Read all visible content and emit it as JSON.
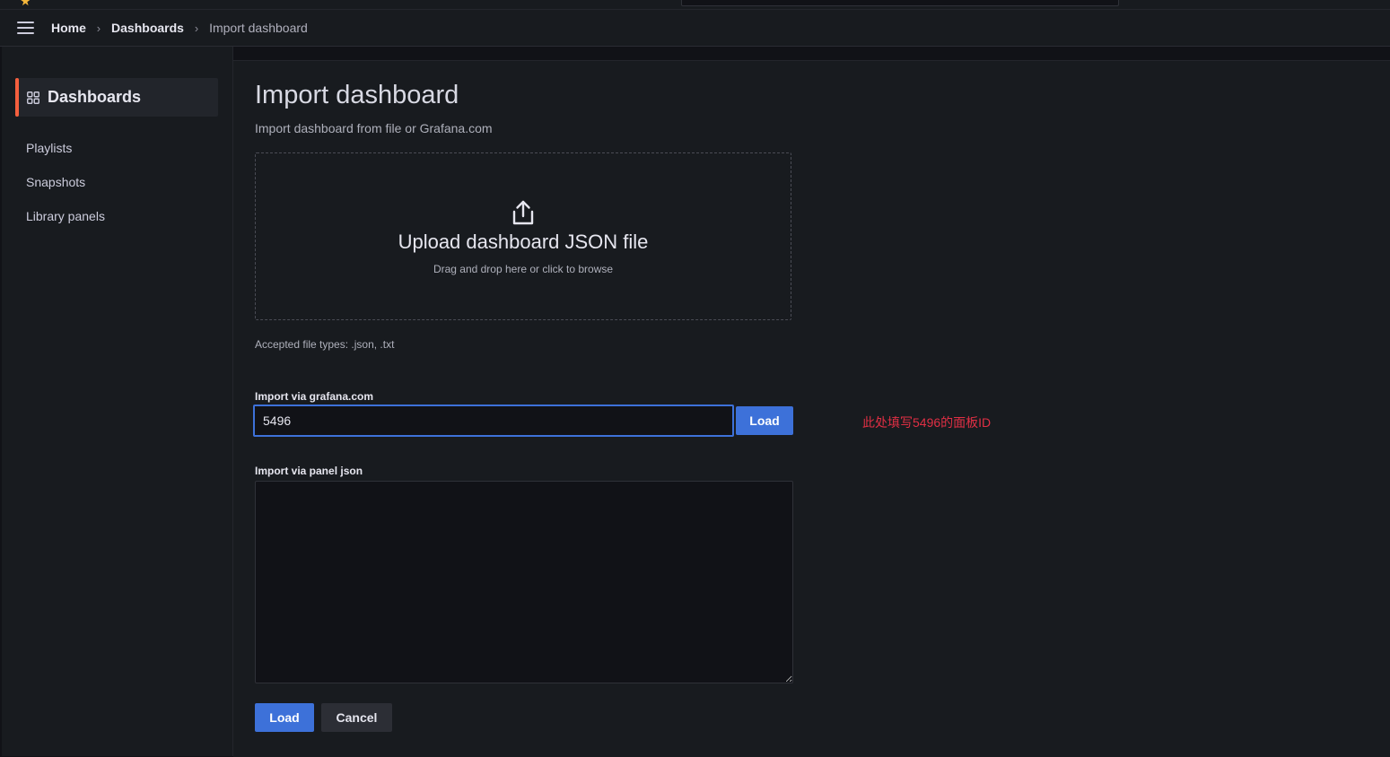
{
  "header": {
    "breadcrumbs": [
      "Home",
      "Dashboards",
      "Import dashboard"
    ],
    "separator": "›"
  },
  "sidebar": {
    "active": {
      "label": "Dashboards",
      "icon": "apps-grid-icon",
      "accent_color": "#f55f3e"
    },
    "items": [
      {
        "label": "Playlists"
      },
      {
        "label": "Snapshots"
      },
      {
        "label": "Library panels"
      }
    ]
  },
  "page": {
    "title": "Import dashboard",
    "subtitle": "Import dashboard from file or Grafana.com"
  },
  "upload": {
    "icon": "upload-icon",
    "title": "Upload dashboard JSON file",
    "hint": "Drag and drop here or click to browse",
    "accepted": "Accepted file types: .json, .txt"
  },
  "grafana_com": {
    "label": "Import via grafana.com",
    "value": "5496",
    "load_label": "Load",
    "annotation": "此处填写5496的面板ID",
    "annotation_color": "#e02f44"
  },
  "panel_json": {
    "label": "Import via panel json",
    "value": ""
  },
  "actions": {
    "load_label": "Load",
    "cancel_label": "Cancel"
  },
  "colors": {
    "primary": "#3d71d9",
    "background": "#111217",
    "panel": "#181b1f"
  }
}
